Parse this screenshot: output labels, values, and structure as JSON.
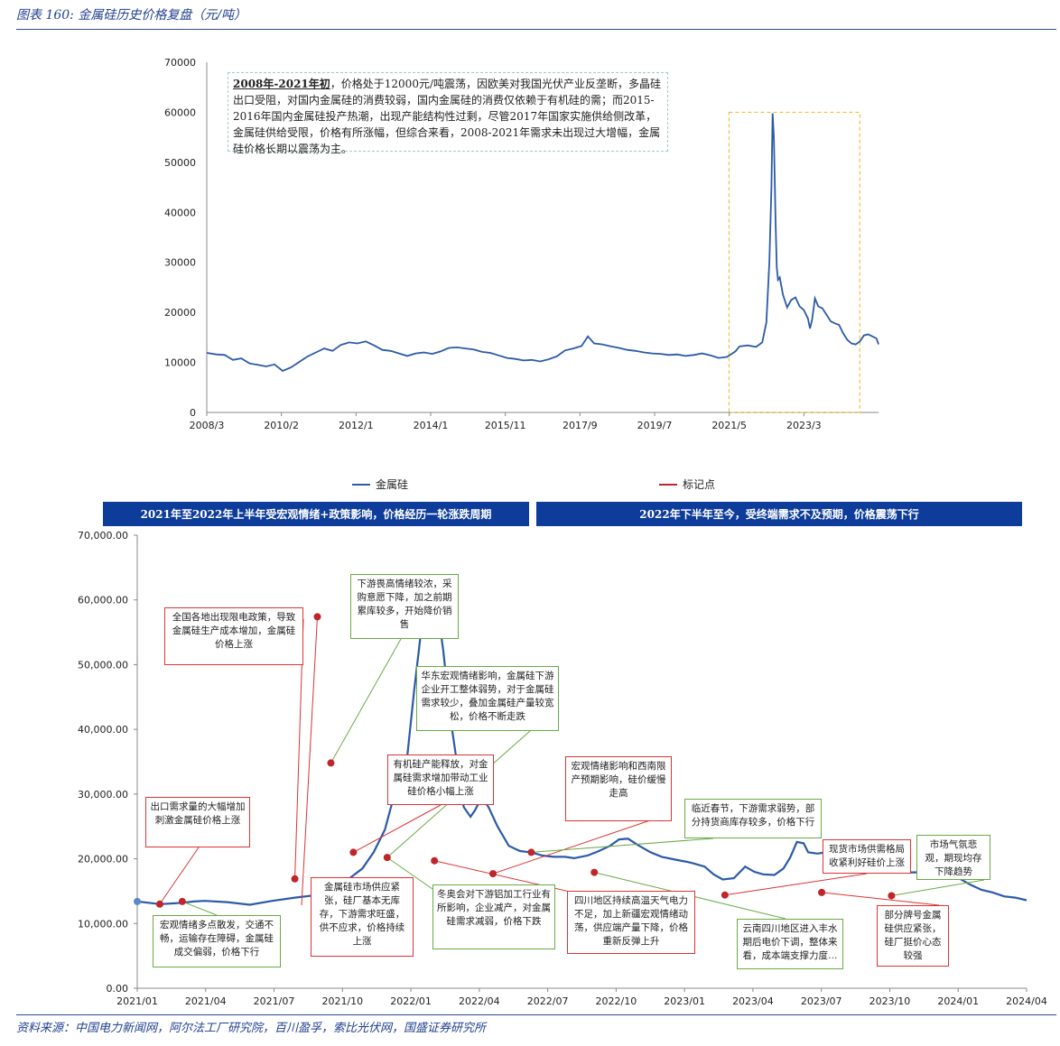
{
  "header": {
    "title": "图表 160: 金属硅历史价格复盘（元/吨）"
  },
  "source": "资料来源：中国电力新闻网，阿尔法工厂研究院，百川盈孚，索比光伏网，国盛证券研究所",
  "top_note": {
    "bold": "2008年-2021年初",
    "text": "，价格处于12000元/吨震荡，因欧美对我国光伏产业反垄断，多晶硅出口受阻，对国内金属硅的消费较弱，国内金属硅的消费仅依赖于有机硅的需；而2015-2016年国内金属硅投产热潮，出现产能结构性过剩，尽管2017年国家实施供给侧改革，金属硅供给受限，价格有所涨幅，但综合来看，2008-2021年需求未出现过大增幅，金属硅价格长期以震荡为主。"
  },
  "legend": {
    "series1": "金属硅",
    "series2": "标记点"
  },
  "banners": {
    "left": "2021年至2022年上半年受宏观情绪+政策影响，价格经历一轮涨跌周期",
    "right": "2022年下半年至今，受终端需求不及预期，价格震荡下行"
  },
  "notes": [
    {
      "id": "n1",
      "color": "red",
      "text": "出口需求量的大幅增加刺激金属硅价格上涨"
    },
    {
      "id": "n2",
      "color": "green",
      "text": "宏观情绪多点散发，交通不畅，运输存在障碍，金属硅成交偏弱，价格下行"
    },
    {
      "id": "n3",
      "color": "red",
      "text": "全国各地出现限电政策，导致金属硅生产成本增加，金属硅价格上涨"
    },
    {
      "id": "n4",
      "color": "red",
      "text": "金属硅市场供应紧张，硅厂基本无库存，下游需求旺盛，供不应求，价格持续上涨"
    },
    {
      "id": "n5",
      "color": "green",
      "text": "下游畏高情绪较浓，采购意愿下降，加之前期累库较多，开始降价销售"
    },
    {
      "id": "n6",
      "color": "red",
      "text": "有机硅产能释放，对金属硅需求增加带动工业硅价格小幅上涨"
    },
    {
      "id": "n7",
      "color": "green",
      "text": "华东宏观情绪影响，金属硅下游企业开工整体弱势，对于金属硅需求较少，叠加金属硅产量较宽松，价格不断走跌"
    },
    {
      "id": "n8",
      "color": "green",
      "text": "冬奥会对下游铝加工行业有所影响，企业减产，对金属硅需求减弱，价格下跌"
    },
    {
      "id": "n9",
      "color": "red",
      "text": "宏观情绪影响和西南限产预期影响，硅价缓慢走高"
    },
    {
      "id": "n10",
      "color": "red",
      "text": "四川地区持续高温天气电力不足，加上新疆宏观情绪动荡，供应端产量下降，价格重新反弹上升"
    },
    {
      "id": "n11",
      "color": "green",
      "text": "临近春节，下游需求弱势，部分持货商库存较多，价格下行"
    },
    {
      "id": "n12",
      "color": "green",
      "text": "云南四川地区进入丰水期后电价下调，整体来看，成本端支撑力度…"
    },
    {
      "id": "n13",
      "color": "red",
      "text": "现货市场供需格局收紧利好硅价上涨"
    },
    {
      "id": "n14",
      "color": "green",
      "text": "市场气氛悲观，期现均存下降趋势"
    },
    {
      "id": "n15",
      "color": "red",
      "text": "部分牌号金属硅供应紧张，硅厂挺价心态较强"
    }
  ],
  "colors": {
    "line": "#2b5aa8",
    "marker": "#c0252a",
    "marker_first": "#5b86c8",
    "highlight": "#f0c040",
    "banner": "#0e3c9a"
  },
  "chart_data": [
    {
      "type": "line",
      "title": "",
      "series": [
        {
          "name": "金属硅"
        }
      ],
      "x_ticks": [
        "2008/3",
        "2010/2",
        "2012/1",
        "2014/1",
        "2015/11",
        "2017/9",
        "2019/7",
        "2021/5",
        "2023/3"
      ],
      "y_ticks": [
        "0",
        "10000",
        "20000",
        "30000",
        "40000",
        "50000",
        "60000",
        "70000"
      ],
      "ylim": [
        0,
        70000
      ],
      "xlim": [
        2008.17,
        2024.35
      ],
      "highlight_range": {
        "x": [
          2020.75,
          2023.9
        ],
        "y": [
          0,
          60000
        ]
      },
      "points": [
        [
          2008.17,
          11900
        ],
        [
          2008.4,
          11600
        ],
        [
          2008.6,
          11500
        ],
        [
          2008.8,
          10500
        ],
        [
          2009.0,
          10800
        ],
        [
          2009.2,
          9800
        ],
        [
          2009.4,
          9500
        ],
        [
          2009.6,
          9200
        ],
        [
          2009.8,
          9600
        ],
        [
          2010.0,
          8300
        ],
        [
          2010.2,
          9000
        ],
        [
          2010.4,
          10100
        ],
        [
          2010.6,
          11200
        ],
        [
          2010.8,
          12000
        ],
        [
          2011.0,
          12800
        ],
        [
          2011.2,
          12300
        ],
        [
          2011.4,
          13500
        ],
        [
          2011.6,
          14000
        ],
        [
          2011.8,
          13800
        ],
        [
          2012.0,
          14200
        ],
        [
          2012.2,
          13400
        ],
        [
          2012.4,
          12500
        ],
        [
          2012.6,
          12300
        ],
        [
          2012.8,
          11800
        ],
        [
          2013.0,
          11300
        ],
        [
          2013.2,
          11800
        ],
        [
          2013.4,
          12000
        ],
        [
          2013.6,
          11700
        ],
        [
          2013.8,
          12200
        ],
        [
          2014.0,
          12900
        ],
        [
          2014.2,
          13000
        ],
        [
          2014.4,
          12800
        ],
        [
          2014.6,
          12600
        ],
        [
          2014.8,
          12100
        ],
        [
          2015.0,
          11900
        ],
        [
          2015.2,
          11400
        ],
        [
          2015.4,
          10900
        ],
        [
          2015.6,
          10700
        ],
        [
          2015.8,
          10400
        ],
        [
          2016.0,
          10500
        ],
        [
          2016.2,
          10200
        ],
        [
          2016.4,
          10600
        ],
        [
          2016.6,
          11200
        ],
        [
          2016.8,
          12400
        ],
        [
          2017.0,
          12800
        ],
        [
          2017.2,
          13300
        ],
        [
          2017.35,
          15200
        ],
        [
          2017.5,
          13800
        ],
        [
          2017.7,
          13600
        ],
        [
          2017.9,
          13200
        ],
        [
          2018.1,
          12900
        ],
        [
          2018.3,
          12500
        ],
        [
          2018.5,
          12300
        ],
        [
          2018.7,
          12000
        ],
        [
          2018.9,
          11800
        ],
        [
          2019.1,
          11700
        ],
        [
          2019.3,
          11500
        ],
        [
          2019.5,
          11600
        ],
        [
          2019.7,
          11300
        ],
        [
          2019.9,
          11500
        ],
        [
          2020.1,
          11800
        ],
        [
          2020.3,
          11400
        ],
        [
          2020.5,
          10900
        ],
        [
          2020.7,
          11100
        ],
        [
          2020.9,
          12200
        ],
        [
          2021.0,
          13200
        ],
        [
          2021.2,
          13400
        ],
        [
          2021.4,
          13100
        ],
        [
          2021.55,
          14000
        ],
        [
          2021.65,
          18000
        ],
        [
          2021.72,
          30000
        ],
        [
          2021.77,
          45000
        ],
        [
          2021.8,
          59800
        ],
        [
          2021.83,
          55000
        ],
        [
          2021.87,
          38000
        ],
        [
          2021.9,
          29000
        ],
        [
          2021.93,
          26500
        ],
        [
          2021.97,
          27000
        ],
        [
          2022.05,
          23500
        ],
        [
          2022.15,
          21000
        ],
        [
          2022.25,
          22500
        ],
        [
          2022.35,
          23000
        ],
        [
          2022.45,
          21200
        ],
        [
          2022.55,
          20500
        ],
        [
          2022.65,
          18800
        ],
        [
          2022.7,
          16800
        ],
        [
          2022.75,
          18500
        ],
        [
          2022.82,
          22800
        ],
        [
          2022.9,
          21200
        ],
        [
          2023.0,
          20800
        ],
        [
          2023.1,
          19500
        ],
        [
          2023.2,
          18200
        ],
        [
          2023.3,
          17800
        ],
        [
          2023.4,
          17500
        ],
        [
          2023.5,
          15800
        ],
        [
          2023.6,
          14500
        ],
        [
          2023.7,
          13800
        ],
        [
          2023.8,
          13600
        ],
        [
          2023.9,
          14200
        ],
        [
          2024.0,
          15400
        ],
        [
          2024.1,
          15600
        ],
        [
          2024.2,
          15200
        ],
        [
          2024.3,
          14800
        ],
        [
          2024.35,
          13600
        ]
      ]
    },
    {
      "type": "line",
      "title": "",
      "series": [
        {
          "name": "金属硅"
        },
        {
          "name": "标记点"
        }
      ],
      "x_ticks": [
        "2021/01",
        "2021/04",
        "2021/07",
        "2021/10",
        "2022/01",
        "2022/04",
        "2022/07",
        "2022/10",
        "2023/01",
        "2023/04",
        "2023/07",
        "2023/10",
        "2024/01",
        "2024/04"
      ],
      "y_ticks": [
        "0.00",
        "10,000.00",
        "20,000.00",
        "30,000.00",
        "40,000.00",
        "50,000.00",
        "60,000.00",
        "70,000.00"
      ],
      "ylim": [
        0,
        70000
      ],
      "xlim": [
        0,
        39.5
      ],
      "points": [
        [
          0,
          13400
        ],
        [
          0.5,
          13200
        ],
        [
          1,
          13000
        ],
        [
          1.5,
          13100
        ],
        [
          2,
          13200
        ],
        [
          2.5,
          13400
        ],
        [
          3,
          13500
        ],
        [
          4,
          13300
        ],
        [
          5,
          12900
        ],
        [
          6,
          13500
        ],
        [
          7,
          14000
        ],
        [
          8,
          14400
        ],
        [
          9,
          15000
        ],
        [
          9.4,
          16900
        ],
        [
          10,
          18500
        ],
        [
          10.5,
          21000
        ],
        [
          11,
          24500
        ],
        [
          11.5,
          31000
        ],
        [
          12,
          36000
        ],
        [
          12.3,
          46000
        ],
        [
          12.6,
          55000
        ],
        [
          12.8,
          58500
        ],
        [
          13.0,
          59800
        ],
        [
          13.2,
          59000
        ],
        [
          13.4,
          57000
        ],
        [
          13.6,
          52000
        ],
        [
          13.9,
          42000
        ],
        [
          14.2,
          34800
        ],
        [
          14.5,
          28000
        ],
        [
          14.8,
          26500
        ],
        [
          15.0,
          27500
        ],
        [
          15.3,
          29500
        ],
        [
          15.6,
          28000
        ],
        [
          16.0,
          25000
        ],
        [
          16.5,
          22000
        ],
        [
          17.0,
          21200
        ],
        [
          17.5,
          21000
        ],
        [
          18.0,
          20500
        ],
        [
          18.5,
          20300
        ],
        [
          19.0,
          20300
        ],
        [
          19.4,
          20100
        ],
        [
          20.0,
          20500
        ],
        [
          20.5,
          21200
        ],
        [
          21.0,
          22000
        ],
        [
          21.4,
          23000
        ],
        [
          21.8,
          23100
        ],
        [
          22.2,
          22200
        ],
        [
          22.8,
          21000
        ],
        [
          23.3,
          20300
        ],
        [
          24.0,
          19800
        ],
        [
          24.6,
          19400
        ],
        [
          25.2,
          18800
        ],
        [
          25.6,
          17600
        ],
        [
          26.0,
          16800
        ],
        [
          26.5,
          17000
        ],
        [
          27.0,
          18800
        ],
        [
          27.4,
          18000
        ],
        [
          27.8,
          17600
        ],
        [
          28.3,
          17500
        ],
        [
          28.7,
          18500
        ],
        [
          29.0,
          20200
        ],
        [
          29.3,
          22600
        ],
        [
          29.6,
          22400
        ],
        [
          29.8,
          21000
        ],
        [
          30.2,
          20800
        ],
        [
          30.6,
          21000
        ],
        [
          31.0,
          20800
        ],
        [
          31.5,
          20500
        ],
        [
          32.0,
          20000
        ],
        [
          32.5,
          19500
        ],
        [
          33.0,
          18800
        ],
        [
          33.5,
          18300
        ],
        [
          34.0,
          17900
        ],
        [
          34.6,
          17900
        ],
        [
          35.3,
          17600
        ],
        [
          36.0,
          17400
        ],
        [
          36.5,
          17000
        ],
        [
          37.0,
          16000
        ],
        [
          37.5,
          15200
        ],
        [
          38.0,
          14800
        ],
        [
          38.5,
          14200
        ],
        [
          39.0,
          14000
        ],
        [
          39.5,
          13600
        ]
      ],
      "markers": [
        [
          0,
          13400
        ],
        [
          1,
          13000
        ],
        [
          2,
          13400
        ],
        [
          7,
          16900
        ],
        [
          8,
          57400
        ],
        [
          8.6,
          34800
        ],
        [
          9.6,
          21000
        ],
        [
          11.1,
          20200
        ],
        [
          13.2,
          19700
        ],
        [
          15.8,
          17700
        ],
        [
          17.5,
          21000
        ],
        [
          20.3,
          17900
        ],
        [
          26.1,
          14400
        ],
        [
          30.4,
          14800
        ],
        [
          33.5,
          14300
        ]
      ]
    }
  ]
}
